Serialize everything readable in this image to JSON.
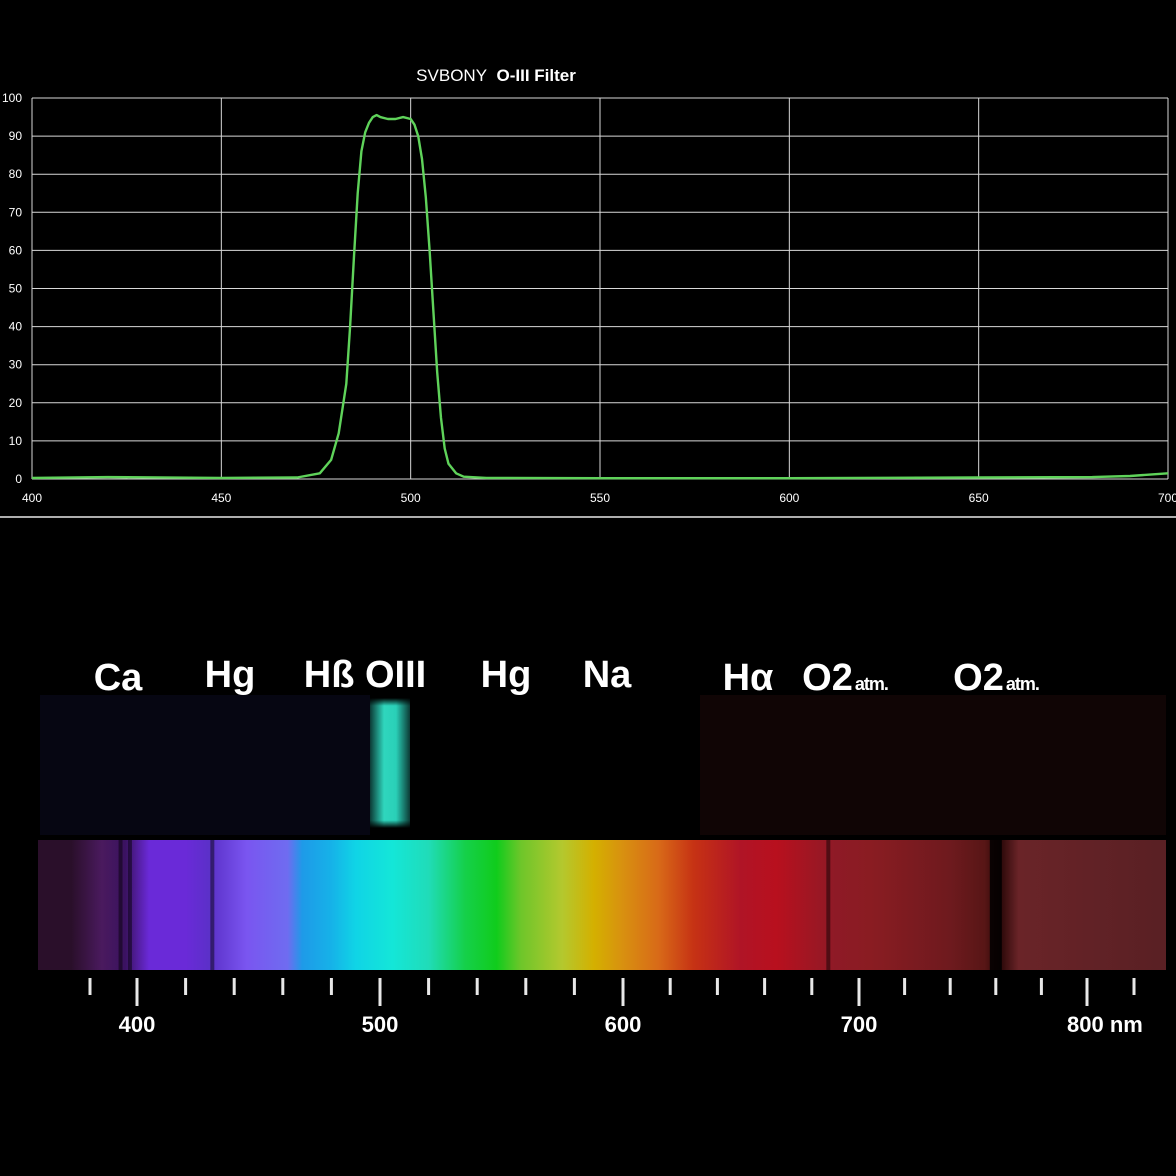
{
  "chart_data": [
    {
      "type": "line",
      "title_brand": "SVBONY",
      "title_product": "O-III Filter",
      "xlim": [
        400,
        700
      ],
      "ylim": [
        0,
        100
      ],
      "x_ticks": [
        400,
        450,
        500,
        550,
        600,
        650,
        700
      ],
      "y_ticks": [
        0,
        10,
        20,
        30,
        40,
        50,
        60,
        70,
        80,
        90,
        100
      ],
      "grid": true,
      "line_color": "#5fd35a",
      "x": [
        400,
        420,
        450,
        470,
        476,
        479,
        481,
        483,
        484,
        485,
        486,
        487,
        488,
        489,
        490,
        491,
        492,
        494,
        496,
        498,
        500,
        501,
        502,
        503,
        504,
        505,
        506,
        507,
        508,
        509,
        510,
        512,
        514,
        520,
        550,
        600,
        650,
        680,
        690,
        700
      ],
      "y": [
        0.3,
        0.5,
        0.3,
        0.4,
        1.5,
        5,
        12,
        25,
        40,
        58,
        75,
        86,
        91,
        93.5,
        95,
        95.5,
        95,
        94.5,
        94.5,
        95,
        94.5,
        93,
        90,
        84,
        74,
        60,
        44,
        28,
        16,
        8,
        4,
        1.5,
        0.6,
        0.3,
        0.2,
        0.2,
        0.4,
        0.5,
        0.8,
        1.5
      ]
    },
    {
      "type": "spectrum",
      "unit": "nm",
      "axis_labels": [
        {
          "value": 400,
          "text": "400"
        },
        {
          "value": 500,
          "text": "500"
        },
        {
          "value": 600,
          "text": "600"
        },
        {
          "value": 700,
          "text": "700"
        },
        {
          "value": 800,
          "text": "800 nm"
        }
      ],
      "minor_ticks": [
        380,
        420,
        440,
        460,
        480,
        520,
        540,
        560,
        580,
        620,
        640,
        660,
        680,
        720,
        740,
        760,
        780,
        820
      ],
      "lines": [
        {
          "label": "Ca",
          "sub": "",
          "wavelength": 393
        },
        {
          "label": "Hg",
          "sub": "",
          "wavelength": 436
        },
        {
          "label": "Hß OIII",
          "sub": "",
          "wavelength": 490
        },
        {
          "label": "Hg",
          "sub": "",
          "wavelength": 546
        },
        {
          "label": "Na",
          "sub": "",
          "wavelength": 589
        },
        {
          "label": "Hα",
          "sub": "",
          "wavelength": 656
        },
        {
          "label": "O2",
          "sub": "atm.",
          "wavelength": 687
        },
        {
          "label": "O2",
          "sub": "atm.",
          "wavelength": 760
        }
      ],
      "emission_band": {
        "wavelength": 505,
        "color": "#2cc9b4"
      },
      "dark_lines": [
        393,
        397,
        431,
        687,
        760
      ]
    }
  ]
}
